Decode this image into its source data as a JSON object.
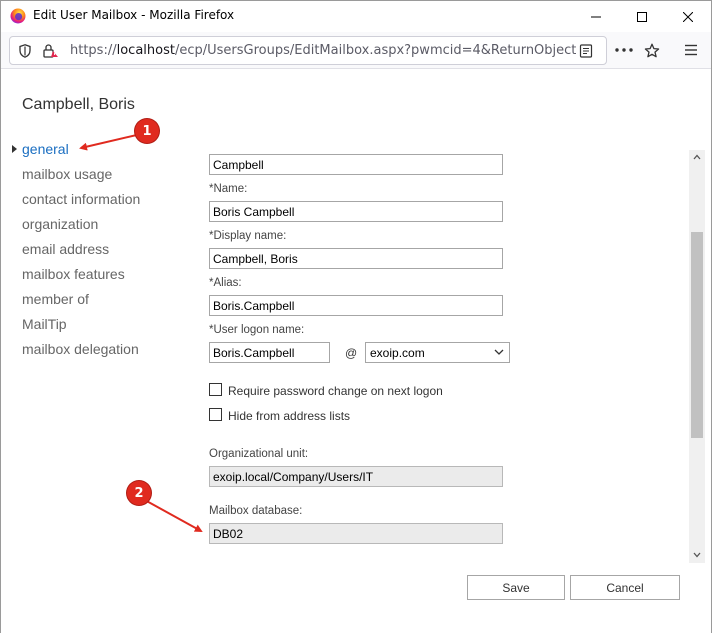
{
  "window": {
    "title": "Edit User Mailbox - Mozilla Firefox"
  },
  "browser": {
    "url_prefix": "https://",
    "url_host": "localhost",
    "url_path": "/ecp/UsersGroups/EditMailbox.aspx?pwmcid=4&ReturnObjectType"
  },
  "page": {
    "user_name": "Campbell, Boris"
  },
  "sidebar": {
    "items": [
      {
        "label": "general",
        "active": true
      },
      {
        "label": "mailbox usage"
      },
      {
        "label": "contact information"
      },
      {
        "label": "organization"
      },
      {
        "label": "email address"
      },
      {
        "label": "mailbox features"
      },
      {
        "label": "member of"
      },
      {
        "label": "MailTip"
      },
      {
        "label": "mailbox delegation"
      }
    ]
  },
  "form": {
    "last_name_value": "Campbell",
    "name_label": "*Name:",
    "name_value": "Boris Campbell",
    "display_name_label": "*Display name:",
    "display_name_value": "Campbell, Boris",
    "alias_label": "*Alias:",
    "alias_value": "Boris.Campbell",
    "logon_label": "*User logon name:",
    "logon_value": "Boris.Campbell",
    "at_sign": "@",
    "domain_value": "exoip.com",
    "require_pw_label": "Require password change on next logon",
    "require_pw_checked": false,
    "hide_label": "Hide from address lists",
    "hide_checked": false,
    "ou_label": "Organizational unit:",
    "ou_value": "exoip.local/Company/Users/IT",
    "db_label": "Mailbox database:",
    "db_value": "DB02"
  },
  "buttons": {
    "save": "Save",
    "cancel": "Cancel"
  },
  "annotations": {
    "badge1": "1",
    "badge2": "2"
  },
  "colors": {
    "accent_link": "#1a6ec1",
    "annotation_red": "#e02a1f"
  }
}
